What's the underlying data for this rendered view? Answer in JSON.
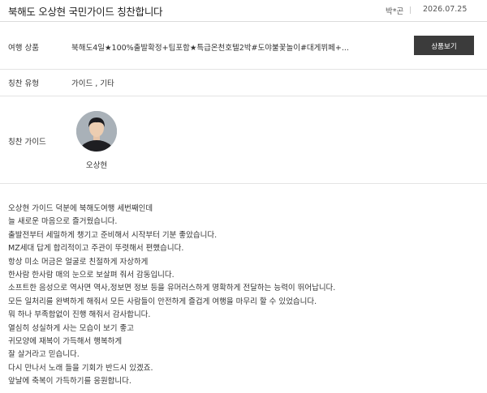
{
  "header": {
    "title": "북해도 오상현 국민가이드 칭찬합니다",
    "author": "박*곤",
    "date": "2026.07.25"
  },
  "product": {
    "label": "여행 상품",
    "value": "북해도4일★100%출발확정+팁포함★특급온천호텔2박#도야불꽃놀이#대게뷔페+...",
    "button": "상품보기"
  },
  "praise_type": {
    "label": "칭찬 유형",
    "value": "가이드 , 기타"
  },
  "praise_guide": {
    "label": "칭찬 가이드",
    "name": "오상현"
  },
  "body_lines": [
    "오상현 가이드 덕분에 북해도여행 세번째인데",
    "늘 새로운 마음으로 즐거웠습니다.",
    "출발전부터 세밀하게 챙기고 준비해서 시작부터 기분 좋았습니다.",
    "MZ세대 답게 합리적이고 주관이 뚜렷해서 편했습니다.",
    "항상 미소 머금은 얼굴로 친절하게 자상하게",
    "한사람 한사람 매의 눈으로 보살펴 줘서 감동입니다.",
    "소프트한 음성으로 역사면 역사,정보면 정보 등을 유머러스하게 명확하게 전달하는 능력이 뛰어납니다.",
    "모든 일처리를 완벽하게 해줘서 모든 사람들이 안전하게 즐겁게 여행을 마무리 할 수 있었습니다.",
    "뭐 하나 부족함없이 진행 해줘서 감사합니다.",
    "열심히 성실하게 사는 모습이 보기 좋고",
    "귀모양에 재복이 가득해서 행복하게",
    "잘 살거라고 믿습니다.",
    "다시 만나서 노래 들을 기회가 반드시 있겠죠.",
    "앞날에 축복이 가득하기를 응원합니다."
  ]
}
